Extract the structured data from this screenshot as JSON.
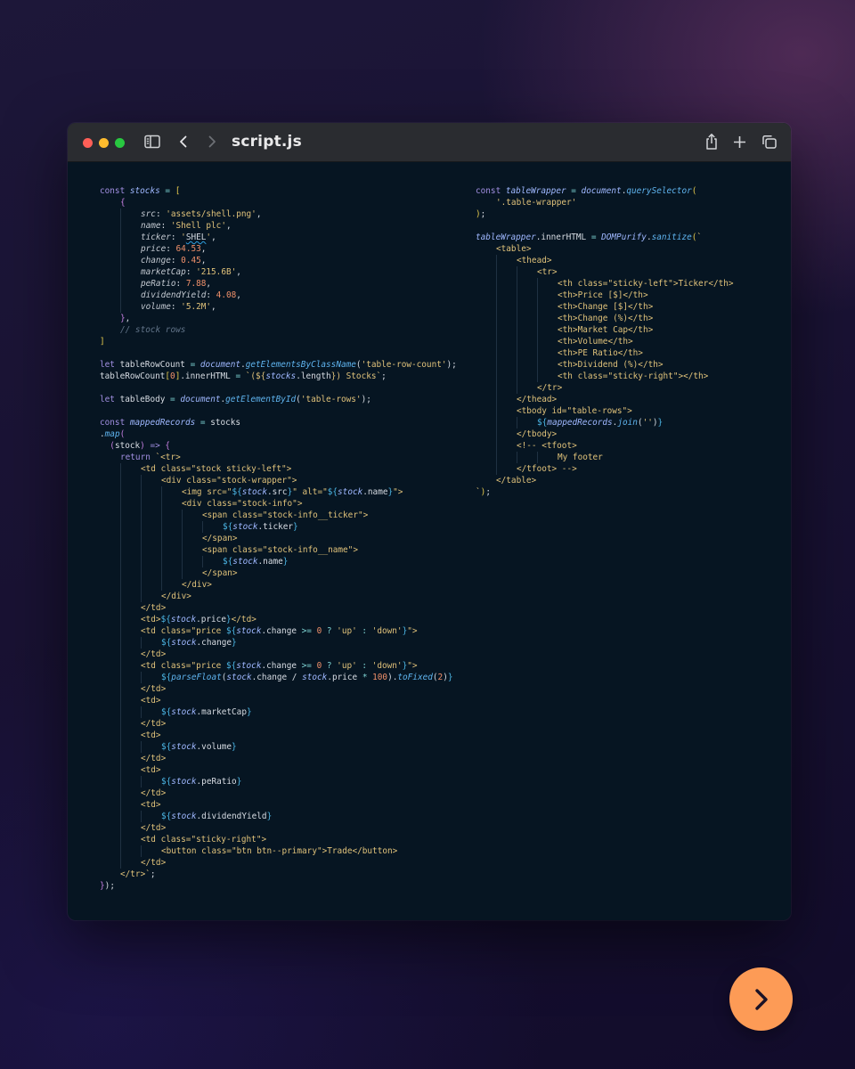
{
  "window": {
    "title": "script.js"
  },
  "icons": {
    "sidebar": "sidebar-toggle-icon",
    "back": "chevron-left-icon",
    "forward": "chevron-right-icon",
    "share": "share-icon",
    "new_tab": "plus-icon",
    "tabs": "tabs-overview-icon",
    "next": "arrow-right-icon"
  },
  "colors": {
    "background": "#1a1434",
    "editor_bg": "#061522",
    "titlebar": "#2a2c30",
    "next_button": "#fd9b56",
    "keyword": "#a08ee0",
    "string": "#e0c27a",
    "number": "#f0906a",
    "function": "#5fb4ef"
  },
  "code_left": [
    {
      "i": 0,
      "s": [
        [
          "kw",
          "const "
        ],
        [
          "var",
          "stocks"
        ],
        [
          "op",
          " = "
        ],
        [
          "br",
          "["
        ]
      ]
    },
    {
      "i": 1,
      "s": [
        [
          "pu",
          "{"
        ]
      ]
    },
    {
      "i": 2,
      "s": [
        [
          "prop",
          "src"
        ],
        [
          "tx",
          ": "
        ],
        [
          "str",
          "'assets/shell.png'"
        ],
        [
          "tx",
          ","
        ]
      ]
    },
    {
      "i": 2,
      "s": [
        [
          "prop",
          "name"
        ],
        [
          "tx",
          ": "
        ],
        [
          "str",
          "'Shell plc'"
        ],
        [
          "tx",
          ","
        ]
      ]
    },
    {
      "i": 2,
      "s": [
        [
          "prop",
          "ticker"
        ],
        [
          "tx",
          ": "
        ],
        [
          "str",
          "'"
        ],
        [
          "sq",
          "SHEL"
        ],
        [
          "str",
          "'"
        ],
        [
          "tx",
          ","
        ]
      ]
    },
    {
      "i": 2,
      "s": [
        [
          "prop",
          "price"
        ],
        [
          "tx",
          ": "
        ],
        [
          "num",
          "64.53"
        ],
        [
          "tx",
          ","
        ]
      ]
    },
    {
      "i": 2,
      "s": [
        [
          "prop",
          "change"
        ],
        [
          "tx",
          ": "
        ],
        [
          "num",
          "0.45"
        ],
        [
          "tx",
          ","
        ]
      ]
    },
    {
      "i": 2,
      "s": [
        [
          "prop",
          "marketCap"
        ],
        [
          "tx",
          ": "
        ],
        [
          "str",
          "'215.6B'"
        ],
        [
          "tx",
          ","
        ]
      ]
    },
    {
      "i": 2,
      "s": [
        [
          "prop",
          "peRatio"
        ],
        [
          "tx",
          ": "
        ],
        [
          "num",
          "7.88"
        ],
        [
          "tx",
          ","
        ]
      ]
    },
    {
      "i": 2,
      "s": [
        [
          "prop",
          "dividendYield"
        ],
        [
          "tx",
          ": "
        ],
        [
          "num",
          "4.08"
        ],
        [
          "tx",
          ","
        ]
      ]
    },
    {
      "i": 2,
      "s": [
        [
          "prop",
          "volume"
        ],
        [
          "tx",
          ": "
        ],
        [
          "str",
          "'5.2M'"
        ],
        [
          "tx",
          ","
        ]
      ]
    },
    {
      "i": 1,
      "s": [
        [
          "pu",
          "}"
        ],
        [
          "tx",
          ","
        ]
      ]
    },
    {
      "i": 1,
      "s": [
        [
          "cm",
          "// stock rows"
        ]
      ]
    },
    {
      "i": 0,
      "s": [
        [
          "br",
          "]"
        ]
      ]
    },
    {
      "i": 0,
      "s": []
    },
    {
      "i": 0,
      "s": [
        [
          "kw",
          "let "
        ],
        [
          "tx",
          "tableRowCount "
        ],
        [
          "op",
          "= "
        ],
        [
          "var",
          "document"
        ],
        [
          "tx",
          "."
        ],
        [
          "fn",
          "getElementsByClassName"
        ],
        [
          "tx",
          "("
        ],
        [
          "str",
          "'table-row-count'"
        ],
        [
          "tx",
          ");"
        ]
      ]
    },
    {
      "i": 0,
      "s": [
        [
          "tx",
          "tableRowCount"
        ],
        [
          "br",
          "["
        ],
        [
          "num",
          "0"
        ],
        [
          "br",
          "]"
        ],
        [
          "tx",
          ".innerHTML "
        ],
        [
          "op",
          "= "
        ],
        [
          "str",
          "`(${"
        ],
        [
          "var",
          "stocks"
        ],
        [
          "tx",
          ".length"
        ],
        [
          "str",
          "}) Stocks`"
        ],
        [
          "tx",
          ";"
        ]
      ]
    },
    {
      "i": 0,
      "s": []
    },
    {
      "i": 0,
      "s": [
        [
          "kw",
          "let "
        ],
        [
          "tx",
          "tableBody "
        ],
        [
          "op",
          "= "
        ],
        [
          "var",
          "document"
        ],
        [
          "tx",
          "."
        ],
        [
          "fn",
          "getElementById"
        ],
        [
          "tx",
          "("
        ],
        [
          "str",
          "'table-rows'"
        ],
        [
          "tx",
          ");"
        ]
      ]
    },
    {
      "i": 0,
      "s": []
    },
    {
      "i": 0,
      "s": [
        [
          "kw",
          "const "
        ],
        [
          "var",
          "mappedRecords"
        ],
        [
          "op",
          " = "
        ],
        [
          "tx",
          "stocks"
        ]
      ]
    },
    {
      "i": 0,
      "s": [
        [
          "tx",
          "."
        ],
        [
          "fn",
          "map"
        ],
        [
          "pu",
          "("
        ]
      ]
    },
    {
      "i": 0,
      "s": [
        [
          "pu",
          "  ("
        ],
        [
          "tx",
          "stock"
        ],
        [
          "pu",
          ")"
        ],
        [
          "kw",
          " => "
        ],
        [
          "pu",
          "{"
        ]
      ]
    },
    {
      "i": 1,
      "s": [
        [
          "kw",
          "return "
        ],
        [
          "str",
          "`<tr>"
        ]
      ]
    },
    {
      "i": 2,
      "s": [
        [
          "str",
          "<td class=\"stock sticky-left\">"
        ]
      ]
    },
    {
      "i": 3,
      "s": [
        [
          "str",
          "<div class=\"stock-wrapper\">"
        ]
      ]
    },
    {
      "i": 4,
      "s": [
        [
          "str",
          "<img src=\""
        ],
        [
          "ip",
          "${"
        ],
        [
          "var",
          "stock"
        ],
        [
          "tx",
          ".src"
        ],
        [
          "ip",
          "}"
        ],
        [
          "str",
          "\" alt=\""
        ],
        [
          "ip",
          "${"
        ],
        [
          "var",
          "stock"
        ],
        [
          "tx",
          ".name"
        ],
        [
          "ip",
          "}"
        ],
        [
          "str",
          "\">"
        ]
      ]
    },
    {
      "i": 4,
      "s": [
        [
          "str",
          "<div class=\"stock-info\">"
        ]
      ]
    },
    {
      "i": 5,
      "s": [
        [
          "str",
          "<span class=\"stock-info__ticker\">"
        ]
      ]
    },
    {
      "i": 6,
      "s": [
        [
          "ip",
          "${"
        ],
        [
          "var",
          "stock"
        ],
        [
          "tx",
          ".ticker"
        ],
        [
          "ip",
          "}"
        ]
      ]
    },
    {
      "i": 5,
      "s": [
        [
          "str",
          "</span>"
        ]
      ]
    },
    {
      "i": 5,
      "s": [
        [
          "str",
          "<span class=\"stock-info__name\">"
        ]
      ]
    },
    {
      "i": 6,
      "s": [
        [
          "ip",
          "${"
        ],
        [
          "var",
          "stock"
        ],
        [
          "tx",
          ".name"
        ],
        [
          "ip",
          "}"
        ]
      ]
    },
    {
      "i": 5,
      "s": [
        [
          "str",
          "</span>"
        ]
      ]
    },
    {
      "i": 4,
      "s": [
        [
          "str",
          "</div>"
        ]
      ]
    },
    {
      "i": 3,
      "s": [
        [
          "str",
          "</div>"
        ]
      ]
    },
    {
      "i": 2,
      "s": [
        [
          "str",
          "</td>"
        ]
      ]
    },
    {
      "i": 2,
      "s": [
        [
          "str",
          "<td>"
        ],
        [
          "ip",
          "${"
        ],
        [
          "var",
          "stock"
        ],
        [
          "tx",
          ".price"
        ],
        [
          "ip",
          "}"
        ],
        [
          "str",
          "</td>"
        ]
      ]
    },
    {
      "i": 2,
      "s": [
        [
          "str",
          "<td class=\"price "
        ],
        [
          "ip",
          "${"
        ],
        [
          "var",
          "stock"
        ],
        [
          "tx",
          ".change "
        ],
        [
          "op",
          ">= "
        ],
        [
          "num",
          "0"
        ],
        [
          "op",
          " ? "
        ],
        [
          "str",
          "'up'"
        ],
        [
          "op",
          " : "
        ],
        [
          "str",
          "'down'"
        ],
        [
          "ip",
          "}"
        ],
        [
          "str",
          "\">"
        ]
      ]
    },
    {
      "i": 3,
      "s": [
        [
          "ip",
          "${"
        ],
        [
          "var",
          "stock"
        ],
        [
          "tx",
          ".change"
        ],
        [
          "ip",
          "}"
        ]
      ]
    },
    {
      "i": 2,
      "s": [
        [
          "str",
          "</td>"
        ]
      ]
    },
    {
      "i": 2,
      "s": [
        [
          "str",
          "<td class=\"price "
        ],
        [
          "ip",
          "${"
        ],
        [
          "var",
          "stock"
        ],
        [
          "tx",
          ".change "
        ],
        [
          "op",
          ">= "
        ],
        [
          "num",
          "0"
        ],
        [
          "op",
          " ? "
        ],
        [
          "str",
          "'up'"
        ],
        [
          "op",
          " : "
        ],
        [
          "str",
          "'down'"
        ],
        [
          "ip",
          "}"
        ],
        [
          "str",
          "\">"
        ]
      ]
    },
    {
      "i": 3,
      "s": [
        [
          "ip",
          "${"
        ],
        [
          "fn",
          "parseFloat"
        ],
        [
          "tx",
          "("
        ],
        [
          "var",
          "stock"
        ],
        [
          "tx",
          ".change / "
        ],
        [
          "var",
          "stock"
        ],
        [
          "tx",
          ".price "
        ],
        [
          "op",
          "* "
        ],
        [
          "num",
          "100"
        ],
        [
          "tx",
          ")."
        ],
        [
          "fn",
          "toFixed"
        ],
        [
          "tx",
          "("
        ],
        [
          "num",
          "2"
        ],
        [
          "tx",
          ")"
        ],
        [
          "ip",
          "}"
        ]
      ]
    },
    {
      "i": 2,
      "s": [
        [
          "str",
          "</td>"
        ]
      ]
    },
    {
      "i": 2,
      "s": [
        [
          "str",
          "<td>"
        ]
      ]
    },
    {
      "i": 3,
      "s": [
        [
          "ip",
          "${"
        ],
        [
          "var",
          "stock"
        ],
        [
          "tx",
          ".marketCap"
        ],
        [
          "ip",
          "}"
        ]
      ]
    },
    {
      "i": 2,
      "s": [
        [
          "str",
          "</td>"
        ]
      ]
    },
    {
      "i": 2,
      "s": [
        [
          "str",
          "<td>"
        ]
      ]
    },
    {
      "i": 3,
      "s": [
        [
          "ip",
          "${"
        ],
        [
          "var",
          "stock"
        ],
        [
          "tx",
          ".volume"
        ],
        [
          "ip",
          "}"
        ]
      ]
    },
    {
      "i": 2,
      "s": [
        [
          "str",
          "</td>"
        ]
      ]
    },
    {
      "i": 2,
      "s": [
        [
          "str",
          "<td>"
        ]
      ]
    },
    {
      "i": 3,
      "s": [
        [
          "ip",
          "${"
        ],
        [
          "var",
          "stock"
        ],
        [
          "tx",
          ".peRatio"
        ],
        [
          "ip",
          "}"
        ]
      ]
    },
    {
      "i": 2,
      "s": [
        [
          "str",
          "</td>"
        ]
      ]
    },
    {
      "i": 2,
      "s": [
        [
          "str",
          "<td>"
        ]
      ]
    },
    {
      "i": 3,
      "s": [
        [
          "ip",
          "${"
        ],
        [
          "var",
          "stock"
        ],
        [
          "tx",
          ".dividendYield"
        ],
        [
          "ip",
          "}"
        ]
      ]
    },
    {
      "i": 2,
      "s": [
        [
          "str",
          "</td>"
        ]
      ]
    },
    {
      "i": 2,
      "s": [
        [
          "str",
          "<td class=\"sticky-right\">"
        ]
      ]
    },
    {
      "i": 3,
      "s": [
        [
          "str",
          "<button class=\"btn btn--primary\">Trade</button>"
        ]
      ]
    },
    {
      "i": 2,
      "s": [
        [
          "str",
          "</td>"
        ]
      ]
    },
    {
      "i": 1,
      "s": [
        [
          "str",
          "</tr>`"
        ],
        [
          "tx",
          ";"
        ]
      ]
    },
    {
      "i": 0,
      "s": [
        [
          "pu",
          "}"
        ],
        [
          "tx",
          ")"
        ],
        [
          "tx",
          ";"
        ]
      ]
    }
  ],
  "code_right": [
    {
      "i": 0,
      "s": [
        [
          "kw",
          "const "
        ],
        [
          "var",
          "tableWrapper"
        ],
        [
          "op",
          " = "
        ],
        [
          "var",
          "document"
        ],
        [
          "tx",
          "."
        ],
        [
          "fn",
          "querySelector"
        ],
        [
          "br",
          "("
        ]
      ]
    },
    {
      "i": 1,
      "s": [
        [
          "str",
          "'.table-wrapper'"
        ]
      ]
    },
    {
      "i": 0,
      "s": [
        [
          "br",
          ")"
        ],
        [
          "tx",
          ";"
        ]
      ]
    },
    {
      "i": 0,
      "s": []
    },
    {
      "i": 0,
      "s": [
        [
          "var",
          "tableWrapper"
        ],
        [
          "tx",
          ".innerHTML "
        ],
        [
          "op",
          "= "
        ],
        [
          "var",
          "DOMPurify"
        ],
        [
          "tx",
          "."
        ],
        [
          "fn",
          "sanitize"
        ],
        [
          "br",
          "("
        ],
        [
          "str",
          "`"
        ]
      ]
    },
    {
      "i": 1,
      "s": [
        [
          "str",
          "<table>"
        ]
      ]
    },
    {
      "i": 2,
      "s": [
        [
          "str",
          "<thead>"
        ]
      ]
    },
    {
      "i": 3,
      "s": [
        [
          "str",
          "<tr>"
        ]
      ]
    },
    {
      "i": 4,
      "s": [
        [
          "str",
          "<th class=\"sticky-left\">Ticker</th>"
        ]
      ]
    },
    {
      "i": 4,
      "s": [
        [
          "str",
          "<th>Price [$]</th>"
        ]
      ]
    },
    {
      "i": 4,
      "s": [
        [
          "str",
          "<th>Change [$]</th>"
        ]
      ]
    },
    {
      "i": 4,
      "s": [
        [
          "str",
          "<th>Change (%)</th>"
        ]
      ]
    },
    {
      "i": 4,
      "s": [
        [
          "str",
          "<th>Market Cap</th>"
        ]
      ]
    },
    {
      "i": 4,
      "s": [
        [
          "str",
          "<th>Volume</th>"
        ]
      ]
    },
    {
      "i": 4,
      "s": [
        [
          "str",
          "<th>PE Ratio</th>"
        ]
      ]
    },
    {
      "i": 4,
      "s": [
        [
          "str",
          "<th>Dividend (%)</th>"
        ]
      ]
    },
    {
      "i": 4,
      "s": [
        [
          "str",
          "<th class=\"sticky-right\"></th>"
        ]
      ]
    },
    {
      "i": 3,
      "s": [
        [
          "str",
          "</tr>"
        ]
      ]
    },
    {
      "i": 2,
      "s": [
        [
          "str",
          "</thead>"
        ]
      ]
    },
    {
      "i": 2,
      "s": [
        [
          "str",
          "<tbody id=\"table-rows\">"
        ]
      ]
    },
    {
      "i": 3,
      "s": [
        [
          "ip",
          "${"
        ],
        [
          "var",
          "mappedRecords"
        ],
        [
          "tx",
          "."
        ],
        [
          "fn",
          "join"
        ],
        [
          "tx",
          "("
        ],
        [
          "str",
          "''"
        ],
        [
          "tx",
          ")"
        ],
        [
          "ip",
          "}"
        ]
      ]
    },
    {
      "i": 2,
      "s": [
        [
          "str",
          "</tbody>"
        ]
      ]
    },
    {
      "i": 2,
      "s": [
        [
          "str",
          "<!-- <tfoot>"
        ]
      ]
    },
    {
      "i": 4,
      "s": [
        [
          "str",
          "My footer"
        ]
      ]
    },
    {
      "i": 2,
      "s": [
        [
          "str",
          "</tfoot> -->"
        ]
      ]
    },
    {
      "i": 1,
      "s": [
        [
          "str",
          "</table>"
        ]
      ]
    },
    {
      "i": 0,
      "s": [
        [
          "str",
          "`"
        ],
        [
          "br",
          ")"
        ],
        [
          "tx",
          ";"
        ]
      ]
    }
  ]
}
